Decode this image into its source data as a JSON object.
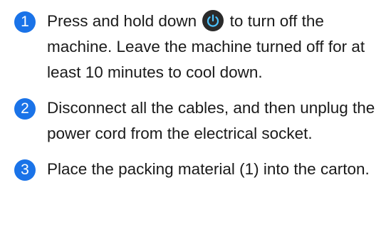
{
  "steps": [
    {
      "number": "1",
      "text_before_icon": "Press and hold down",
      "icon": "power-button-icon",
      "text_after_icon": "to turn off the machine. Leave the machine turned off for at least 10 minutes to cool down."
    },
    {
      "number": "2",
      "text": "Disconnect all the cables, and then unplug the power cord from the electrical socket."
    },
    {
      "number": "3",
      "text": "Place the packing material (1) into the carton."
    }
  ],
  "colors": {
    "step_badge": "#1a73e8",
    "power_icon_bg": "#2a2a2a",
    "power_icon_glyph": "#4cc3ff"
  }
}
